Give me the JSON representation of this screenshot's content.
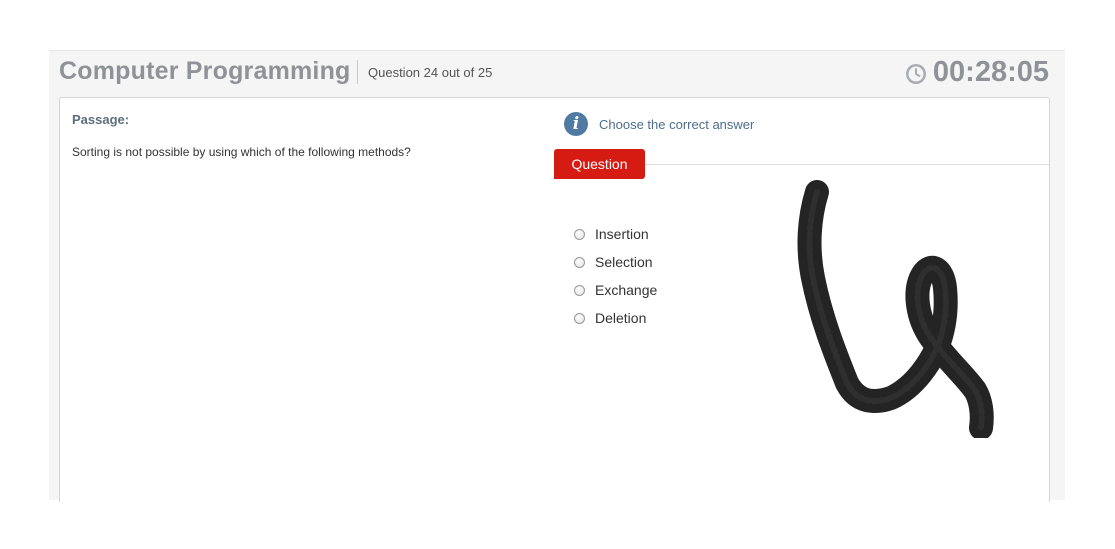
{
  "header": {
    "title": "Computer Programming",
    "question_count": "Question 24 out of 25",
    "timer": "00:28:05",
    "timer_icon": "clock-icon"
  },
  "passage": {
    "label": "Passage:",
    "text": "Sorting is not possible by using which of the following methods?"
  },
  "question_panel": {
    "instruction": "Choose the correct answer",
    "info_icon": "info-icon",
    "tab_label": "Question",
    "options": [
      {
        "label": "Insertion",
        "selected": false
      },
      {
        "label": "Selection",
        "selected": false
      },
      {
        "label": "Exchange",
        "selected": false
      },
      {
        "label": "Deletion",
        "selected": false
      }
    ]
  },
  "colors": {
    "tab_red": "#d51b12",
    "title_gray": "#8f9297",
    "info_blue": "#4f7ba3",
    "scribble": "#111111"
  }
}
